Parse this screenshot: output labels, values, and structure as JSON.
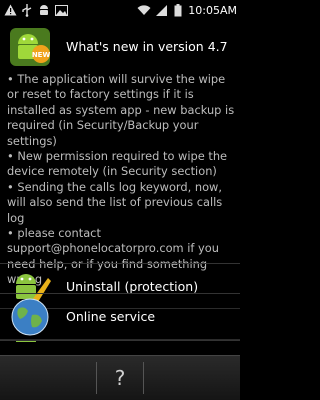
{
  "status_bar": {
    "time": "10:05AM",
    "left_icons": [
      "warning-icon",
      "usb-icon",
      "android-icon",
      "image-icon"
    ],
    "right_icons": [
      "wifi-icon",
      "signal-icon",
      "battery-icon"
    ]
  },
  "whats_new": {
    "title": "What's new in version 4.7",
    "notes": [
      "• The application will survive the wipe or reset to factory settings if it is installed as system app - new backup is required (in Security/Backup your settings)",
      "• New permission required to wipe the device remotely (in Security section)",
      "• Sending the calls log keyword, now, will also send the list of previous calls log",
      "• please contact support@phonelocatorpro.com if you need help, or if you find something wrong"
    ]
  },
  "menu": {
    "items": [
      {
        "label": "Uninstall (protection)",
        "icon": "broom-icon"
      },
      {
        "label": "Online service",
        "icon": "globe-icon"
      }
    ]
  },
  "bottom_bar": {
    "help_label": "?"
  }
}
